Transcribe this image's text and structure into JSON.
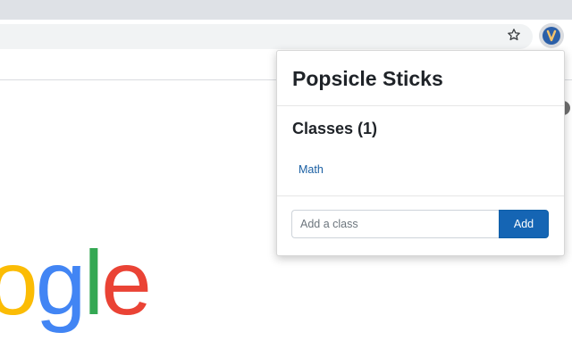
{
  "browser": {
    "extension_icon": "popsicle-stick-icon",
    "bookmark_icon": "star-icon"
  },
  "page": {
    "logo_letters": [
      {
        "char": "o",
        "color": "#fbbc05"
      },
      {
        "char": "g",
        "color": "#4285f4"
      },
      {
        "char": "l",
        "color": "#34a853"
      },
      {
        "char": "e",
        "color": "#ea4335"
      }
    ]
  },
  "popup": {
    "title": "Popsicle Sticks",
    "classes_heading": "Classes (1)",
    "classes": [
      "Math"
    ],
    "add_input": {
      "value": "",
      "placeholder": "Add a class"
    },
    "add_button_label": "Add",
    "accent_color": "#1565b4"
  }
}
